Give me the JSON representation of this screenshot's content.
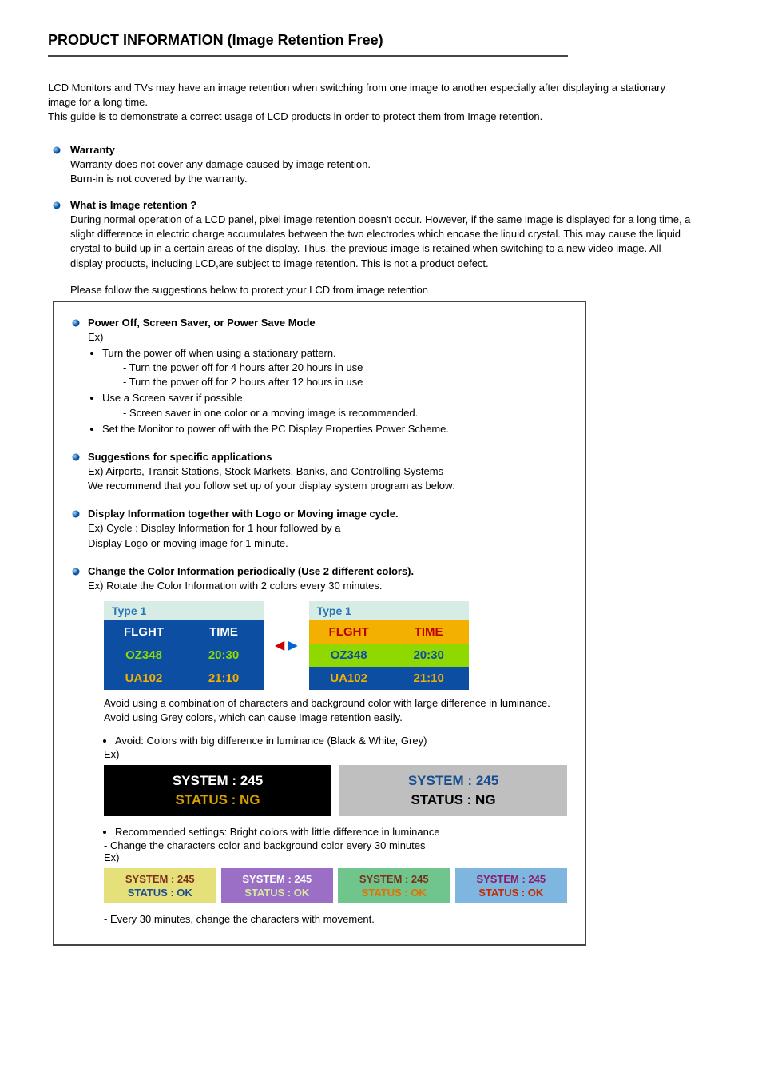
{
  "title": "PRODUCT INFORMATION (Image Retention Free)",
  "intro": {
    "p1": "LCD Monitors and TVs may have an image retention when switching from one image to another especially after displaying a stationary image for a long time.",
    "p2": "This guide is to demonstrate a correct usage of LCD products in order to protect them from Image retention."
  },
  "warranty": {
    "title": "Warranty",
    "l1": "Warranty does not cover any damage caused by image retention.",
    "l2": "Burn-in is not covered by the warranty."
  },
  "what": {
    "title": "What is Image retention ?",
    "body": "During normal operation of a LCD panel, pixel image retention doesn't occur. However, if the same image is displayed for a long time, a slight difference in electric charge accumulates between the two electrodes which encase the liquid crystal. This may cause the liquid crystal to build up in a certain areas of the display. Thus, the previous image is retained when switching to a new video image. All display products, including LCD,are subject to image retention. This is not a product defect."
  },
  "suggestion_lead": "Please follow the suggestions below to protect your LCD from image retention",
  "box": {
    "power": {
      "title": "Power Off, Screen Saver, or Power Save Mode",
      "ex": "Ex)",
      "li1": "Turn the power off when using a stationary pattern.",
      "li1a": "- Turn the power off for 4 hours after 20 hours in use",
      "li1b": "- Turn the power off for 2 hours after 12 hours in use",
      "li2": "Use a Screen saver if possible",
      "li2a": "- Screen saver in one color or a moving image is recommended.",
      "li3": "Set the Monitor to power off with the PC Display Properties Power Scheme."
    },
    "specific": {
      "title": "Suggestions for specific applications",
      "l1": "Ex) Airports, Transit Stations, Stock Markets, Banks, and Controlling Systems",
      "l2": "We recommend that you follow set up of your display system program as below:"
    },
    "logo": {
      "title": "Display Information together with Logo or Moving image cycle.",
      "l1": "Ex) Cycle : Display Information for 1 hour followed by a",
      "l2": "Display Logo or moving image for 1 minute."
    },
    "color": {
      "title": "Change the Color Information periodically (Use 2 different colors).",
      "l1": "Ex) Rotate the Color Information with 2 colors every 30 minutes.",
      "type1": {
        "label": "Type 1",
        "header": [
          "FLGHT",
          "TIME"
        ],
        "rows": [
          [
            "OZ348",
            "20:30"
          ],
          [
            "UA102",
            "21:10"
          ]
        ]
      },
      "avoid_note1": "Avoid using a combination of characters and background color with large difference in luminance.",
      "avoid_note2": "Avoid using Grey colors, which can cause Image retention easily.",
      "avoid_bullet": "Avoid: Colors with big difference in luminance (Black & White, Grey)",
      "ex_label": "Ex)",
      "avoid_ex": {
        "system": "SYSTEM : 245",
        "status": "STATUS : NG"
      },
      "rec_bullet": "Recommended settings: Bright colors with little difference in luminance",
      "rec_sub": "- Change the characters color and background color every 30 minutes",
      "rec_ex": {
        "system": "SYSTEM : 245",
        "status": "STATUS : OK"
      },
      "movement_note": "- Every 30 minutes, change the characters with movement."
    }
  }
}
